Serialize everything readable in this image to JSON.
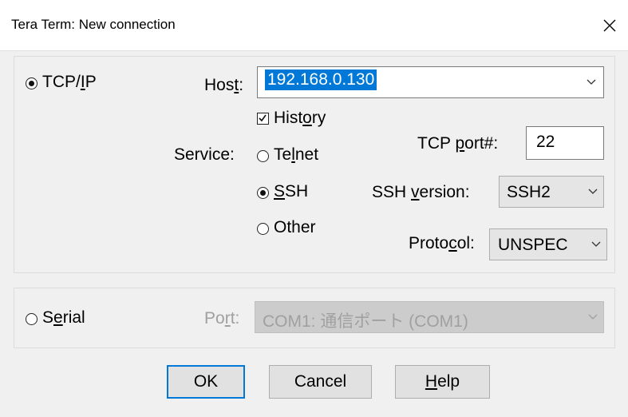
{
  "window": {
    "title": "Tera Term: New connection",
    "close_glyph": "✕"
  },
  "tcpip": {
    "radio_label": "TCP/IP",
    "selected": true,
    "host_label": "Host:",
    "host_value": "192.168.0.130",
    "history_label": "History",
    "history_checked": true,
    "service_label": "Service:",
    "services": [
      {
        "label": "Telnet",
        "selected": false
      },
      {
        "label": "SSH",
        "selected": true
      },
      {
        "label": "Other",
        "selected": false
      }
    ],
    "tcp_port_label": "TCP port#:",
    "tcp_port_value": "22",
    "ssh_version_label": "SSH version:",
    "ssh_version_value": "SSH2",
    "protocol_label": "Protocol:",
    "protocol_value": "UNSPEC"
  },
  "serial": {
    "radio_label": "Serial",
    "selected": false,
    "port_label": "Port:",
    "port_value": "COM1: 通信ポート (COM1)"
  },
  "buttons": {
    "ok": "OK",
    "cancel": "Cancel",
    "help": "Help"
  },
  "colors": {
    "accent": "#0078d7",
    "selection": "#0078d7",
    "dialog_bg": "#f0f0f0"
  },
  "icons": [
    "close-icon",
    "chevron-down-icon",
    "checkmark-icon"
  ]
}
